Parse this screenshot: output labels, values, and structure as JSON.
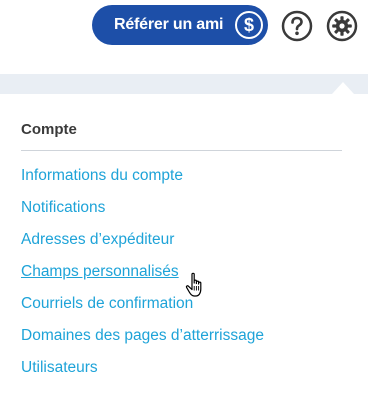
{
  "header": {
    "refer_button_label": "Référer un ami",
    "refer_button_icon": "dollar-icon",
    "refer_button_icon_glyph": "$",
    "help_icon": "help-icon",
    "settings_icon": "gear-icon",
    "accent_color": "#1d4fa8"
  },
  "menu": {
    "section_title": "Compte",
    "link_color": "#1ea3d8",
    "items": [
      {
        "label": "Informations du compte"
      },
      {
        "label": "Notifications"
      },
      {
        "label": "Adresses d’expéditeur"
      },
      {
        "label": "Champs personnalisés",
        "hovered": true
      },
      {
        "label": "Courriels de confirmation"
      },
      {
        "label": "Domaines des pages d’atterrissage"
      },
      {
        "label": "Utilisateurs"
      }
    ]
  }
}
